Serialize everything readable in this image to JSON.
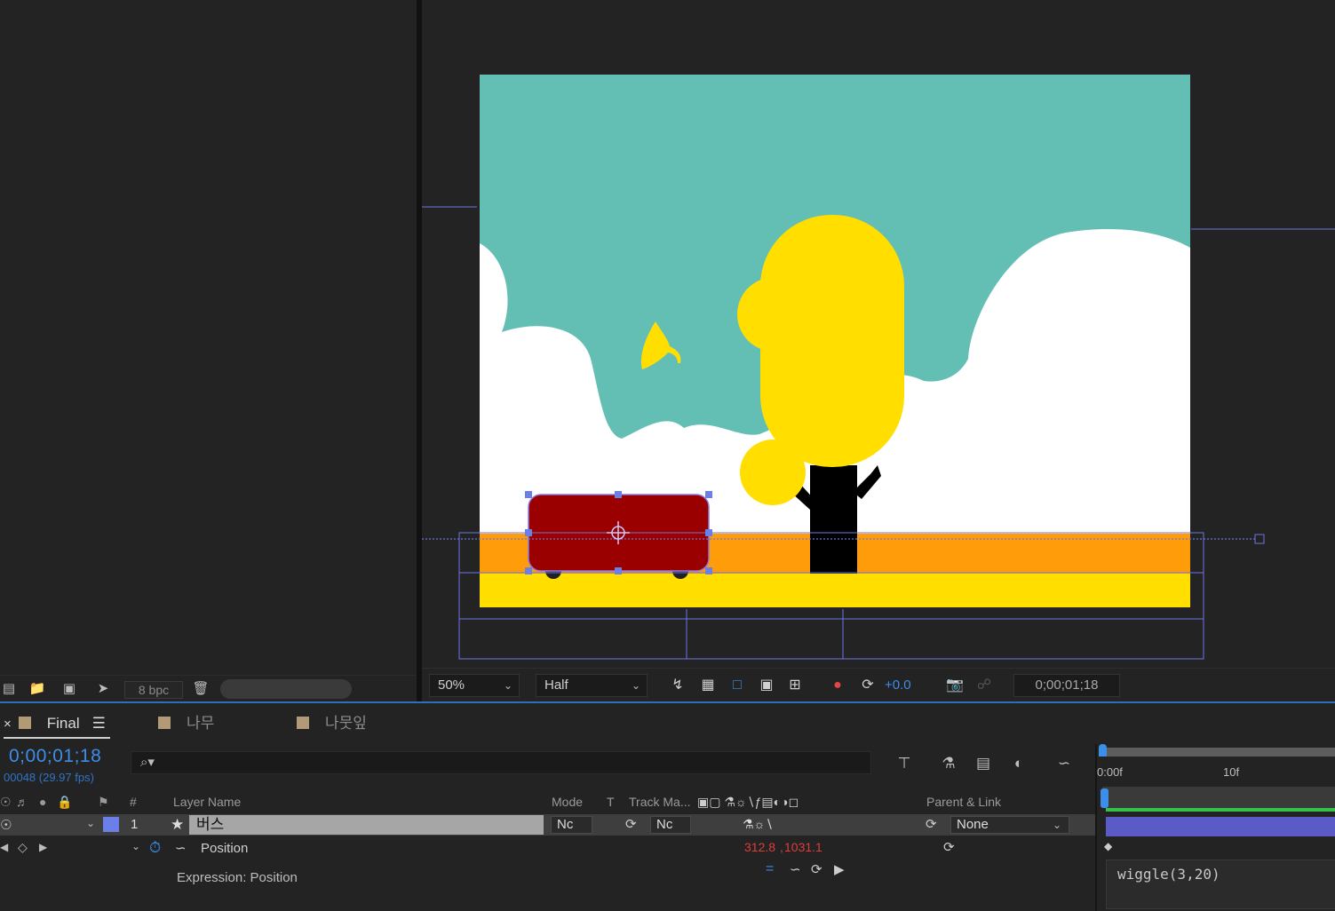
{
  "project_panel": {
    "bit_depth": "8 bpc"
  },
  "viewer": {
    "zoom": "50%",
    "resolution": "Half",
    "exposure": "+0.0",
    "timecode": "0;00;01;18"
  },
  "timeline": {
    "tabs": [
      {
        "label": "Final",
        "active": true
      },
      {
        "label": "나무",
        "active": false
      },
      {
        "label": "나뭇잎",
        "active": false
      }
    ],
    "timecode": "0;00;01;18",
    "frame_info": "00048 (29.97 fps)",
    "search_icon": "⌕▾",
    "columns": {
      "number": "#",
      "layer_name": "Layer Name",
      "mode": "Mode",
      "t": "T",
      "track_matte": "Track Ma...",
      "parent_link": "Parent & Link"
    },
    "layer": {
      "number": "1",
      "name": "버스",
      "mode": "Nc",
      "track_matte": "Nc",
      "parent": "None",
      "label_color": "#6b7fe8"
    },
    "property": {
      "name": "Position",
      "value_x": "312.8",
      "value_y": "1031.1"
    },
    "expression_label": "Expression: Position",
    "expression_code": "wiggle(3,20)",
    "ruler": {
      "start": "0:00f",
      "mark": "10f"
    }
  }
}
